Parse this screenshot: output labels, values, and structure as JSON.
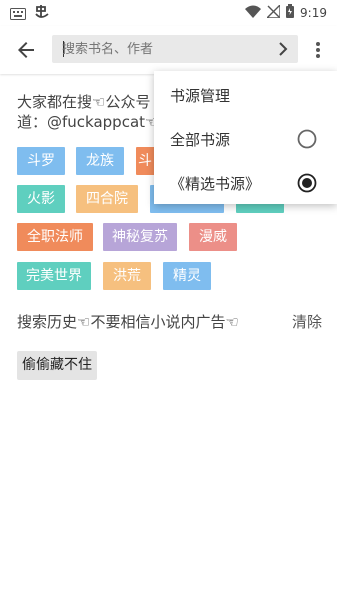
{
  "status_bar": {
    "time": "9:19",
    "icons": [
      "keyboard-icon",
      "app-notification-icon",
      "wifi-icon",
      "no-signal-icon",
      "battery-icon"
    ]
  },
  "app_bar": {
    "search": {
      "placeholder": "搜索书名、作者",
      "value": ""
    }
  },
  "hot_search": {
    "title": "大家都在搜☜公众号 道：@fuckappcat☜",
    "tags": [
      {
        "label": "斗罗",
        "color": "#7fbdef"
      },
      {
        "label": "龙族",
        "color": "#7fbdef"
      },
      {
        "label": "斗",
        "color": "#f08b5b"
      },
      {
        "label": "火影",
        "color": "#5fcfbf"
      },
      {
        "label": "四合院",
        "color": "#f6c07f"
      },
      {
        "label": "",
        "color": "#7fbdef"
      },
      {
        "label": "",
        "color": "#5fcfbf"
      },
      {
        "label": "全职法师",
        "color": "#f08b5b"
      },
      {
        "label": "神秘复苏",
        "color": "#b7a5d8"
      },
      {
        "label": "漫威",
        "color": "#ec8f88"
      },
      {
        "label": "完美世界",
        "color": "#5fcfbf"
      },
      {
        "label": "洪荒",
        "color": "#f6c07f"
      },
      {
        "label": "精灵",
        "color": "#7fbdef"
      }
    ]
  },
  "history": {
    "title": "搜索历史☜不要相信小说内广告☜",
    "clear_label": "清除",
    "items": [
      "偷偷藏不住"
    ]
  },
  "menu": {
    "items": [
      {
        "label": "书源管理",
        "radio": null
      },
      {
        "label": "全部书源",
        "radio": "unselected"
      },
      {
        "label": "《精选书源》",
        "radio": "selected"
      }
    ]
  }
}
